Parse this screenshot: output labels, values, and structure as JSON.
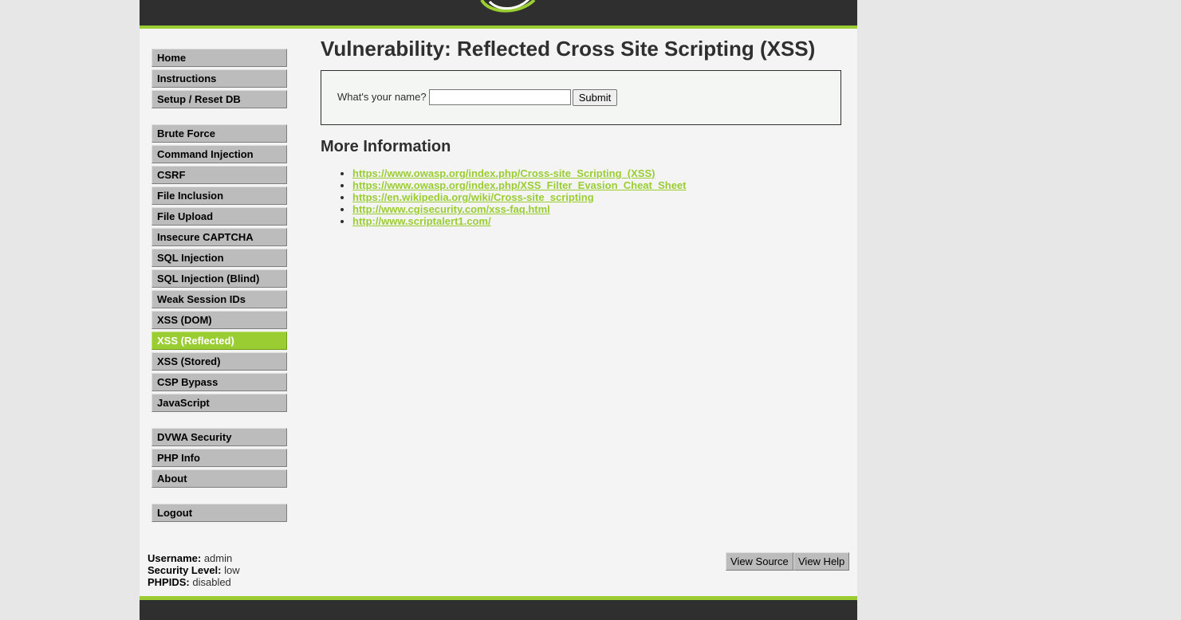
{
  "page_title": "Vulnerability: Reflected Cross Site Scripting (XSS)",
  "form": {
    "label": "What's your name?",
    "input_value": "",
    "submit_label": "Submit"
  },
  "more_info": {
    "heading": "More Information",
    "links": [
      "https://www.owasp.org/index.php/Cross-site_Scripting_(XSS)",
      "https://www.owasp.org/index.php/XSS_Filter_Evasion_Cheat_Sheet",
      "https://en.wikipedia.org/wiki/Cross-site_scripting",
      "http://www.cgisecurity.com/xss-faq.html",
      "http://www.scriptalert1.com/"
    ]
  },
  "menu": {
    "group1": [
      "Home",
      "Instructions",
      "Setup / Reset DB"
    ],
    "group2": [
      "Brute Force",
      "Command Injection",
      "CSRF",
      "File Inclusion",
      "File Upload",
      "Insecure CAPTCHA",
      "SQL Injection",
      "SQL Injection (Blind)",
      "Weak Session IDs",
      "XSS (DOM)",
      "XSS (Reflected)",
      "XSS (Stored)",
      "CSP Bypass",
      "JavaScript"
    ],
    "group3": [
      "DVWA Security",
      "PHP Info",
      "About"
    ],
    "group4": [
      "Logout"
    ],
    "selected": "XSS (Reflected)"
  },
  "user_info": {
    "username_label": "Username:",
    "username": "admin",
    "security_label": "Security Level:",
    "security": "low",
    "phpids_label": "PHPIDS:",
    "phpids": "disabled"
  },
  "buttons": {
    "view_source": "View Source",
    "view_help": "View Help"
  },
  "colors": {
    "accent": "#9acd32",
    "header_bg": "#2f2f2f",
    "page_bg": "#f4f4f4",
    "menu_bg": "#bcbcbc"
  }
}
